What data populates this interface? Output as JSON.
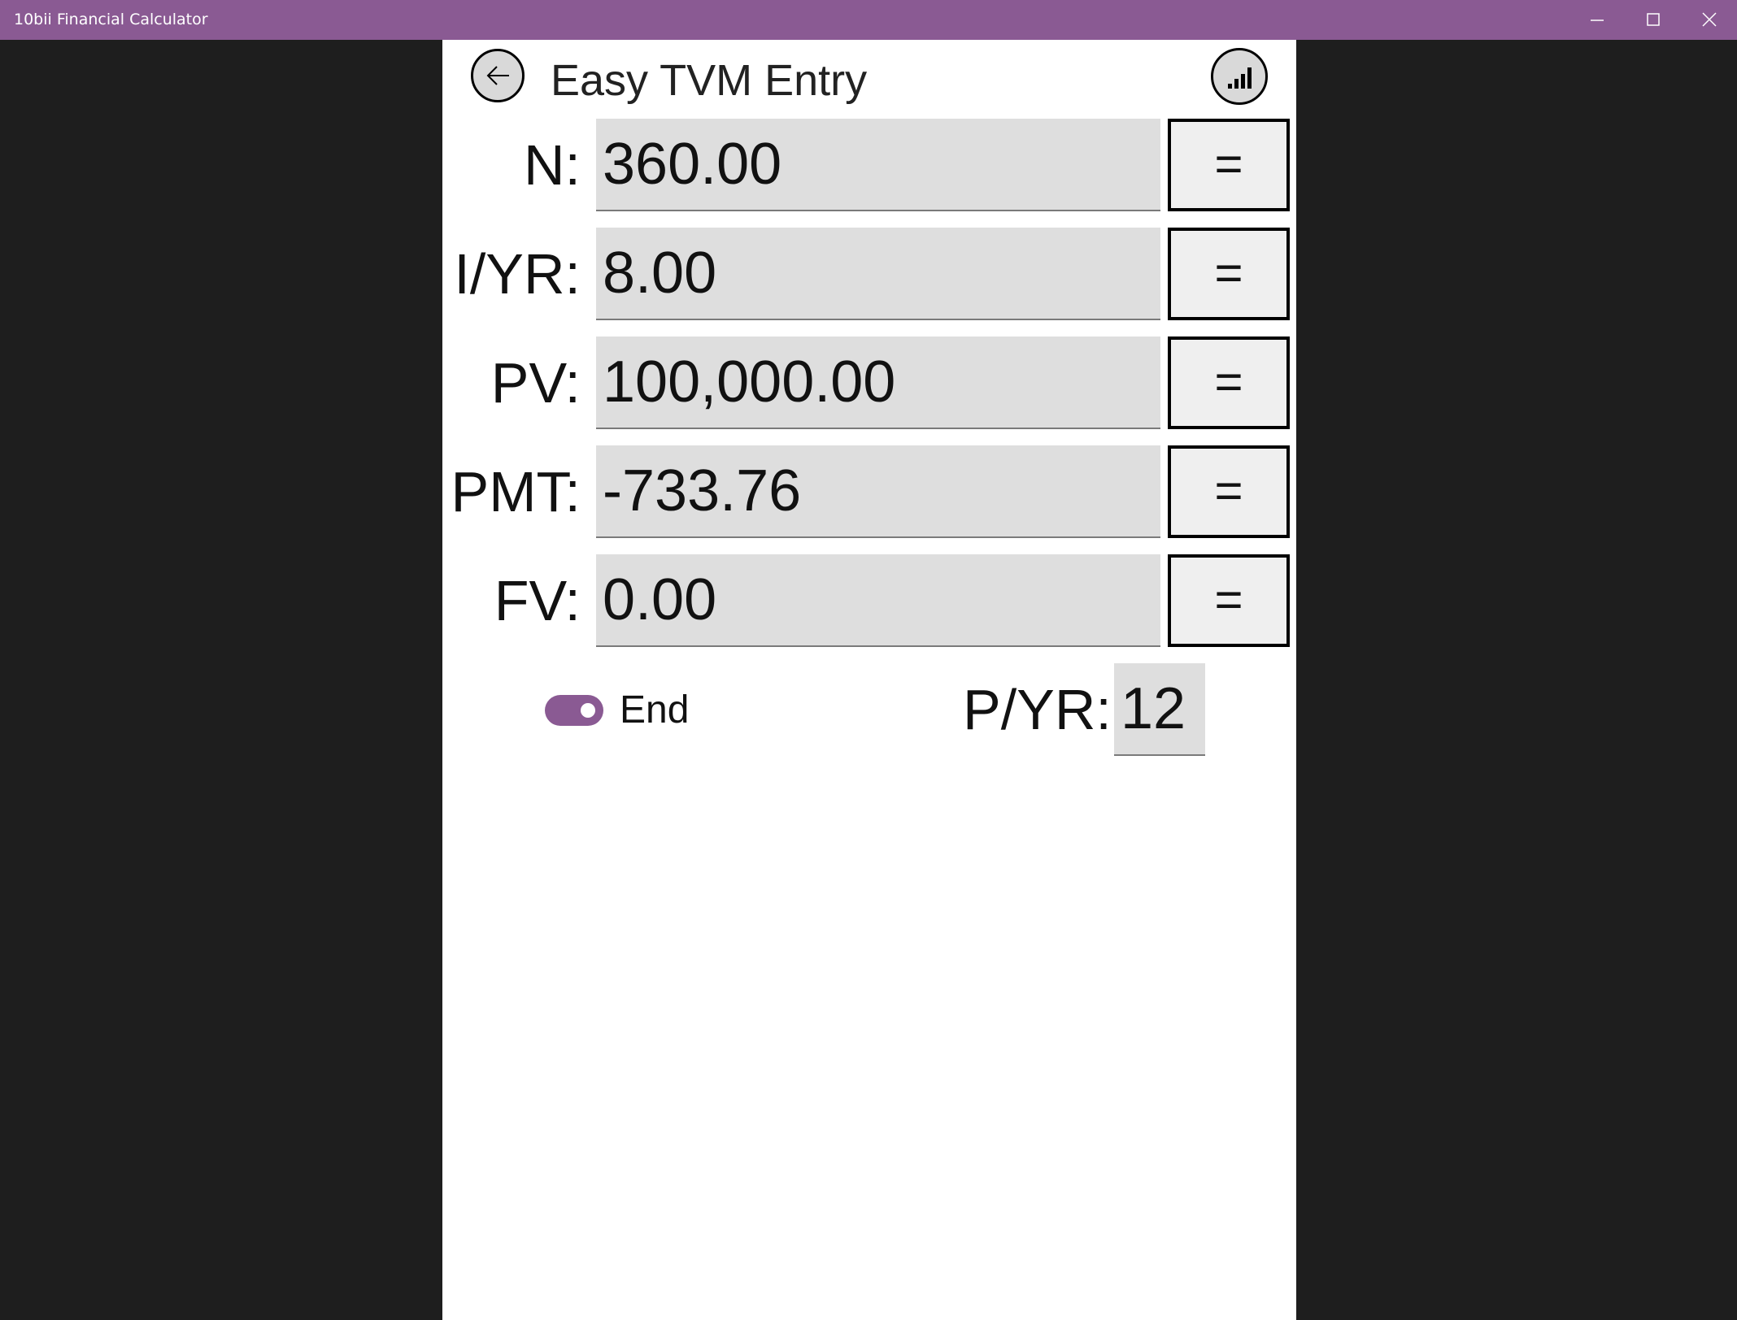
{
  "window": {
    "title": "10bii Financial Calculator",
    "accent_color": "#8a5a93",
    "controls": {
      "minimize_icon": "minimize-icon",
      "maximize_icon": "maximize-icon",
      "close_icon": "close-icon"
    }
  },
  "header": {
    "title": "Easy TVM Entry",
    "back_icon": "arrow-left-icon",
    "chart_icon": "bar-chart-icon"
  },
  "rows": [
    {
      "label": "N:",
      "value": "360.00",
      "button": "="
    },
    {
      "label": "I/YR:",
      "value": "8.00",
      "button": "="
    },
    {
      "label": "PV:",
      "value": "100,000.00",
      "button": "="
    },
    {
      "label": "PMT:",
      "value": "-733.76",
      "button": "="
    },
    {
      "label": "FV:",
      "value": "0.00",
      "button": "="
    }
  ],
  "options": {
    "end_toggle": {
      "label": "End",
      "on": true
    },
    "pyr": {
      "label": "P/YR:",
      "value": "12"
    }
  }
}
